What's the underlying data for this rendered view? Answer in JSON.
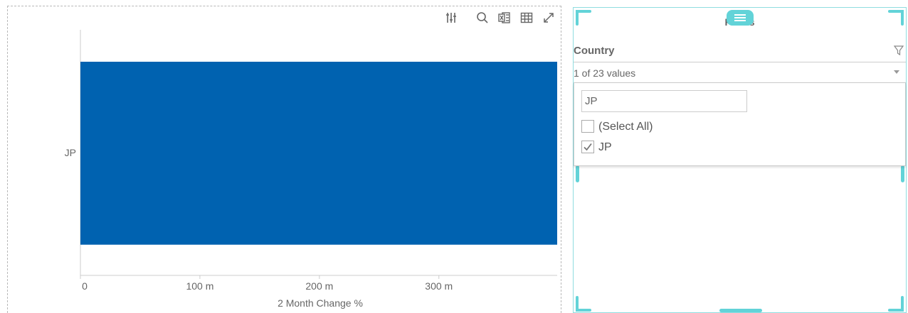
{
  "toolbar": {
    "icons": [
      "settings-sliders-icon",
      "search-icon",
      "export-excel-icon",
      "table-view-icon",
      "expand-icon"
    ]
  },
  "chart_data": {
    "type": "bar",
    "orientation": "horizontal",
    "categories": [
      "JP"
    ],
    "values": [
      399
    ],
    "xlabel": "2 Month Change %",
    "ylabel": "",
    "xlim": [
      0,
      399
    ],
    "x_ticks": [
      0,
      100,
      200,
      300
    ],
    "x_tick_labels": [
      "0",
      "100 m",
      "200 m",
      "300 m"
    ],
    "grid": false,
    "bar_color": "#0062b0"
  },
  "filters": {
    "title": "Filters",
    "accent_color": "#62d3d8",
    "field": {
      "label": "Country",
      "summary": "1 of 23 values",
      "search_value": "JP",
      "options": [
        {
          "label": "(Select All)",
          "checked": false
        },
        {
          "label": "JP",
          "checked": true
        }
      ]
    }
  }
}
